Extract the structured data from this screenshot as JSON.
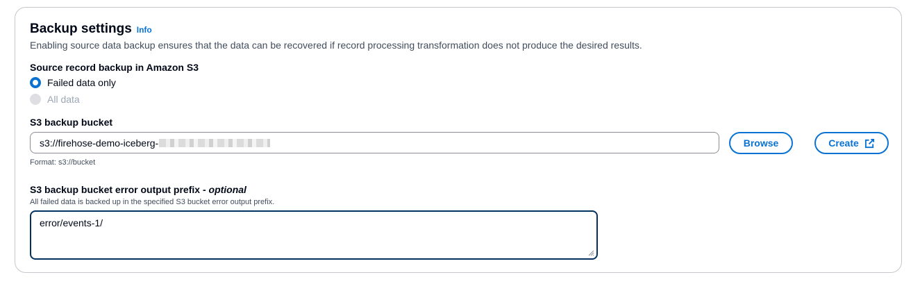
{
  "section": {
    "title": "Backup settings",
    "info_link": "Info",
    "description": "Enabling source data backup ensures that the data can be recovered if record processing transformation does not produce the desired results."
  },
  "source_backup": {
    "label": "Source record backup in Amazon S3",
    "options": [
      {
        "label": "Failed data only",
        "selected": true,
        "disabled": false
      },
      {
        "label": "All data",
        "selected": false,
        "disabled": true
      }
    ]
  },
  "bucket": {
    "label": "S3 backup bucket",
    "value": "s3://firehose-demo-iceberg-",
    "browse_label": "Browse",
    "create_label": "Create",
    "format_hint": "Format: s3://bucket"
  },
  "prefix": {
    "label": "S3 backup bucket error output prefix",
    "optional_label": "optional",
    "description": "All failed data is backed up in the specified S3 bucket error output prefix.",
    "value": "error/events-1/"
  },
  "colors": {
    "accent": "#0972d3",
    "border": "#c6c6cd",
    "text": "#000716",
    "muted": "#414d5c"
  }
}
